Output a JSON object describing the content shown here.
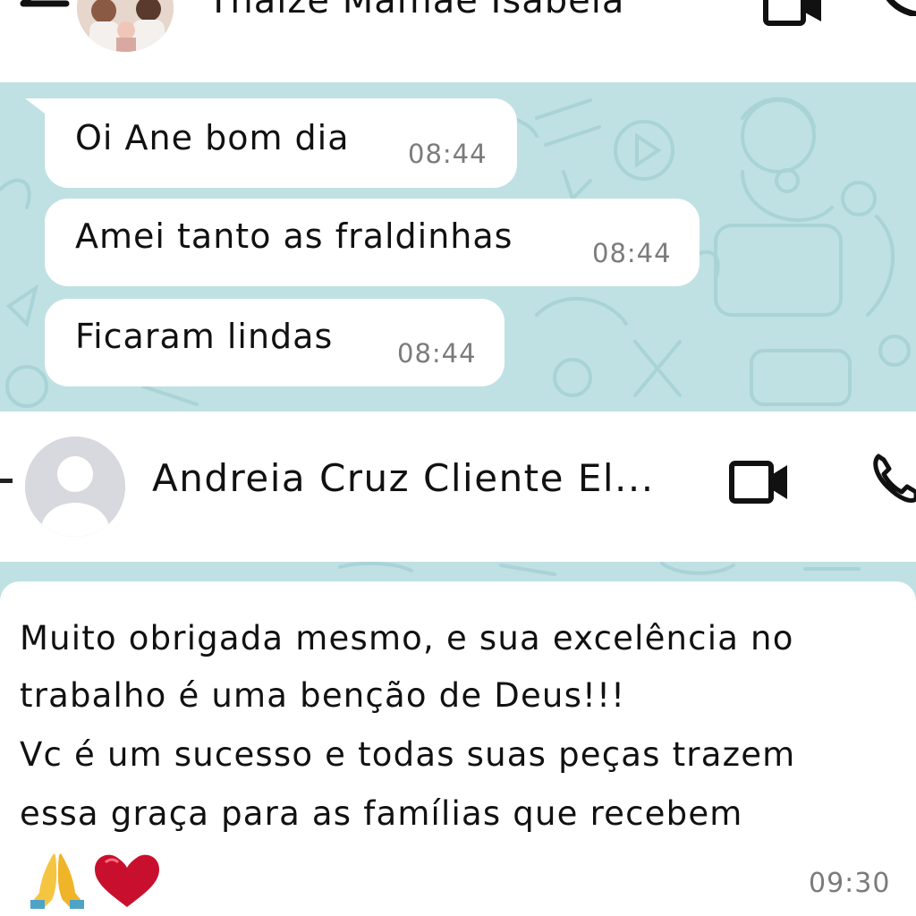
{
  "top_chat": {
    "contact_name": "Thaize Mamãe Isabela",
    "messages": [
      {
        "text": "Oi Ane bom dia",
        "time": "08:44"
      },
      {
        "text": "Amei tanto as fraldinhas",
        "time": "08:44"
      },
      {
        "text": "Ficaram lindas",
        "time": "08:44"
      }
    ]
  },
  "bottom_chat": {
    "contact_name": "Andreia Cruz Cliente El...",
    "message": {
      "lines": [
        "Muito obrigada mesmo, e sua excelência no",
        "trabalho é uma benção de Deus!!!",
        "Vc é um sucesso e todas suas peças trazem",
        "essa graça para as famílias que recebem"
      ],
      "emojis": [
        "pray-emoji",
        "red-heart-emoji"
      ],
      "time": "09:30"
    }
  },
  "colors": {
    "chat_wallpaper": "#bfe1e3",
    "bubble": "#ffffff",
    "timestamp": "#7b7b7b"
  }
}
